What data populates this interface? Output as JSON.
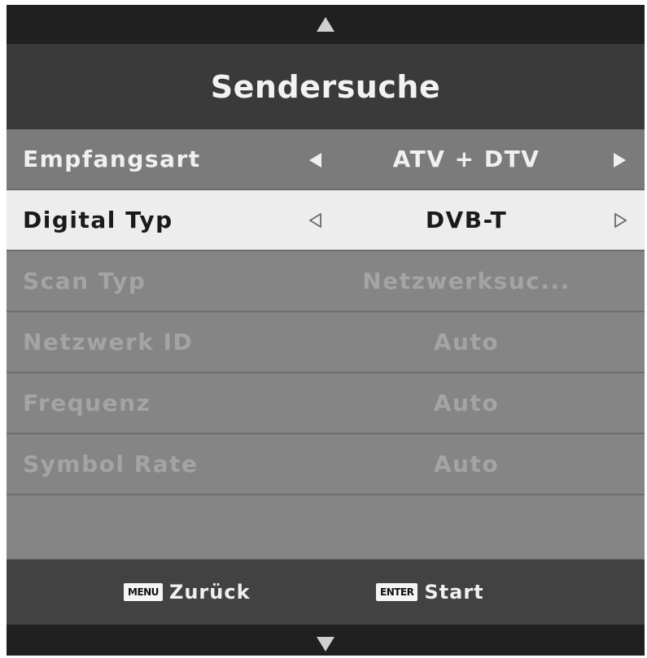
{
  "menu": {
    "title": "Sendersuche",
    "rows": [
      {
        "label": "Empfangsart",
        "value": "ATV + DTV"
      },
      {
        "label": "Digital Typ",
        "value": "DVB-T"
      },
      {
        "label": "Scan Typ",
        "value": "Netzwerksuc..."
      },
      {
        "label": "Netzwerk ID",
        "value": "Auto"
      },
      {
        "label": "Frequenz",
        "value": "Auto"
      },
      {
        "label": "Symbol Rate",
        "value": "Auto"
      }
    ]
  },
  "footer": {
    "back_key": "MENU",
    "back_label": "Zurück",
    "start_key": "ENTER",
    "start_label": "Start"
  },
  "icons": {
    "scroll_up": "triangle-up-icon",
    "scroll_down": "triangle-down-icon",
    "option_left": "triangle-left-icon",
    "option_right": "triangle-right-icon"
  },
  "colors": {
    "selected_row": "#ededed",
    "option_row": "#7b7b7b",
    "disabled_row": "#858585",
    "disabled_text": "#a4a4a4",
    "title_bar": "#3a3a3a"
  }
}
